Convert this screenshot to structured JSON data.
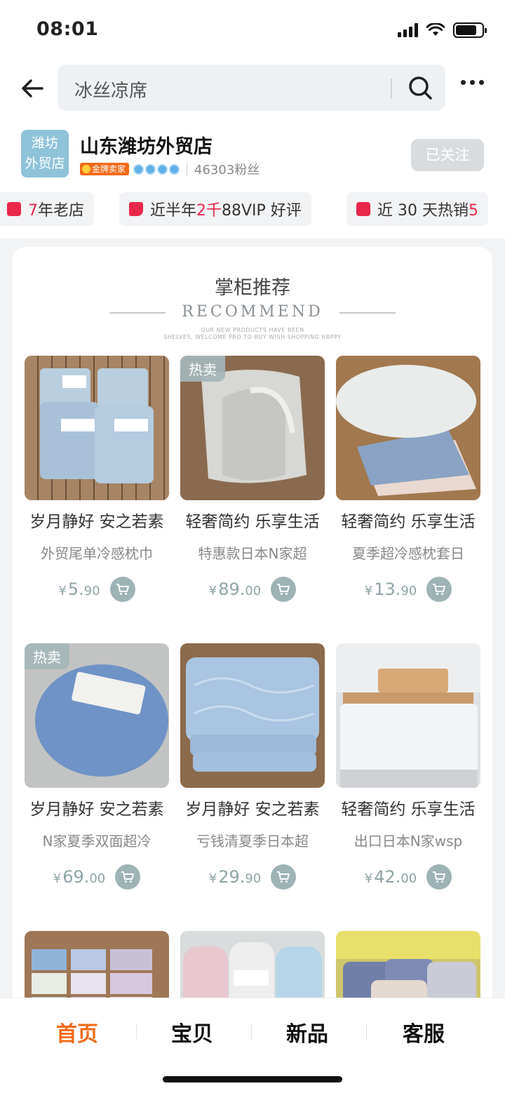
{
  "status": {
    "time": "08:01"
  },
  "search": {
    "query": "冰丝凉席"
  },
  "shop": {
    "logo_line1": "潍坊",
    "logo_line2": "外贸店",
    "name": "山东潍坊外贸店",
    "badge": "金牌卖家",
    "fans": "46303粉丝",
    "follow_label": "已关注"
  },
  "tags": [
    {
      "pre": "",
      "hl": "7",
      "post": "年老店"
    },
    {
      "pre": "近半年",
      "hl": "2千",
      "post": "88VIP 好评"
    },
    {
      "pre": "近 30 天热销",
      "hl": "5",
      "post": ""
    }
  ],
  "recommend": {
    "title": "掌柜推荐",
    "en": "RECOMMEND",
    "sub1": "OUR NEW PRODUCTS HAVE BEEN",
    "sub2": "SHELVES, WELCOME PRO TO BUY WISH SHOPPING HAPPY"
  },
  "products": [
    {
      "name": "岁月静好 安之若素",
      "desc": "外贸尾单冷感枕巾",
      "cur": "¥",
      "int": "5.",
      "dec": "90",
      "hot": ""
    },
    {
      "name": "轻奢简约 乐享生活",
      "desc": "特惠款日本N家超",
      "cur": "¥",
      "int": "89.",
      "dec": "00",
      "hot": "热卖"
    },
    {
      "name": "轻奢简约 乐享生活",
      "desc": "夏季超冷感枕套日",
      "cur": "¥",
      "int": "13.",
      "dec": "90",
      "hot": ""
    },
    {
      "name": "岁月静好 安之若素",
      "desc": "N家夏季双面超冷",
      "cur": "¥",
      "int": "69.",
      "dec": "00",
      "hot": "热卖"
    },
    {
      "name": "岁月静好 安之若素",
      "desc": "亏钱清夏季日本超",
      "cur": "¥",
      "int": "29.",
      "dec": "90",
      "hot": ""
    },
    {
      "name": "轻奢简约 乐享生活",
      "desc": "出口日本N家wsp",
      "cur": "¥",
      "int": "42.",
      "dec": "00",
      "hot": ""
    }
  ],
  "nav": [
    "首页",
    "宝贝",
    "新品",
    "客服"
  ],
  "colors": {
    "accent": "#f36b1c",
    "price": "#8ea4a7",
    "tag_red": "#e8274b"
  }
}
